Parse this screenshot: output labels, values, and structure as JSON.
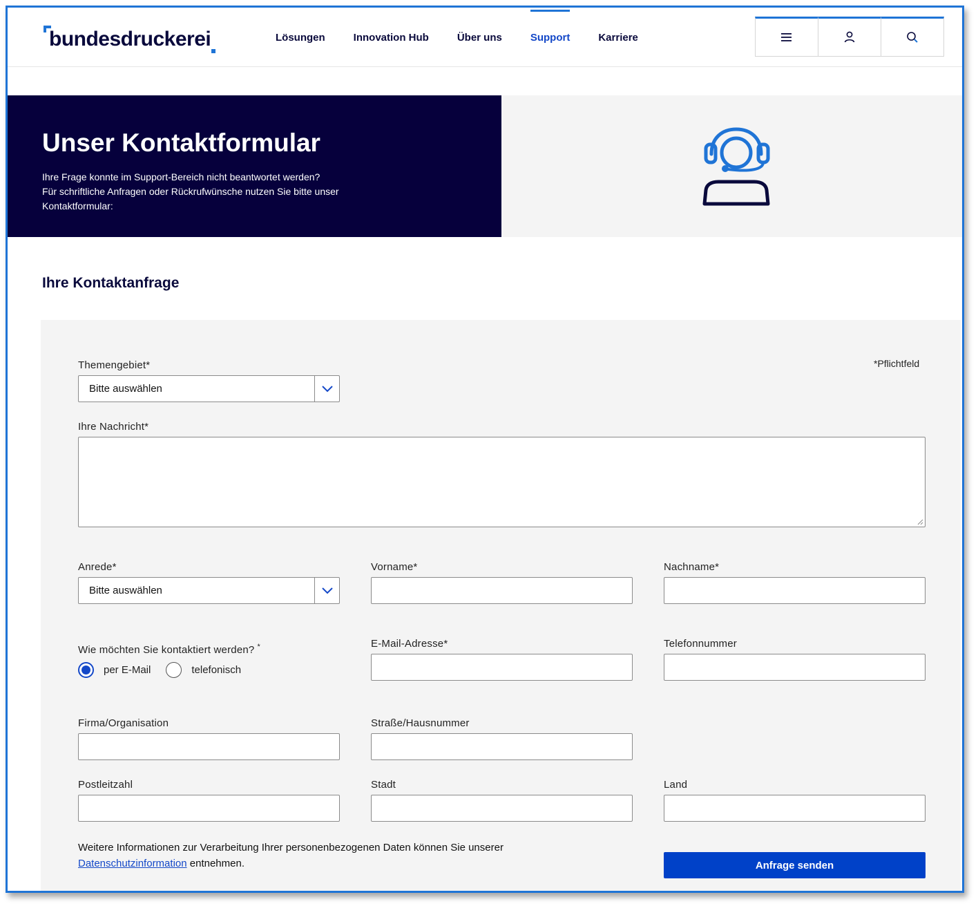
{
  "logo": {
    "text": "bundesdruckerei"
  },
  "nav": [
    {
      "label": "Lösungen"
    },
    {
      "label": "Innovation Hub"
    },
    {
      "label": "Über uns"
    },
    {
      "label": "Support"
    },
    {
      "label": "Karriere"
    }
  ],
  "nav_active": "Support",
  "tools": [
    "menu-icon",
    "user-icon",
    "search-icon"
  ],
  "hero": {
    "title": "Unser Kontaktformular",
    "line1": "Ihre Frage konnte im Support-Bereich nicht beantwortet werden?",
    "line2": "Für schriftliche Anfragen oder Rückrufwünsche nutzen Sie bitte unser",
    "line3": "Kontaktformular:",
    "icon": "headset-agent-icon"
  },
  "form": {
    "section_title": "Ihre Kontaktanfrage",
    "required_note": "*Pflichtfeld",
    "topic_label": "Themengebiet*",
    "topic_value": "Bitte auswählen",
    "message_label": "Ihre Nachricht*",
    "salutation_label": "Anrede*",
    "salutation_value": "Bitte auswählen",
    "firstname_label": "Vorname*",
    "lastname_label": "Nachname*",
    "contact_label": "Wie möchten Sie kontaktiert werden?",
    "contact_req": "*",
    "contact_email": "per E-Mail",
    "contact_phone": "telefonisch",
    "email_label": "E-Mail-Adresse*",
    "phone_label": "Telefonnummer",
    "company_label": "Firma/Organisation",
    "street_label": "Straße/Hausnummer",
    "zip_label": "Postleitzahl",
    "city_label": "Stadt",
    "country_label": "Land",
    "privacy_before": "Weitere Informationen zur Verarbeitung Ihrer personenbezogenen Daten können Sie unserer",
    "privacy_link": "Datenschutzinformation",
    "privacy_after": "entnehmen.",
    "submit": "Anfrage senden"
  },
  "colors": {
    "brand_dark": "#06003c",
    "accent": "#1f74d6",
    "button": "#0041c8"
  }
}
